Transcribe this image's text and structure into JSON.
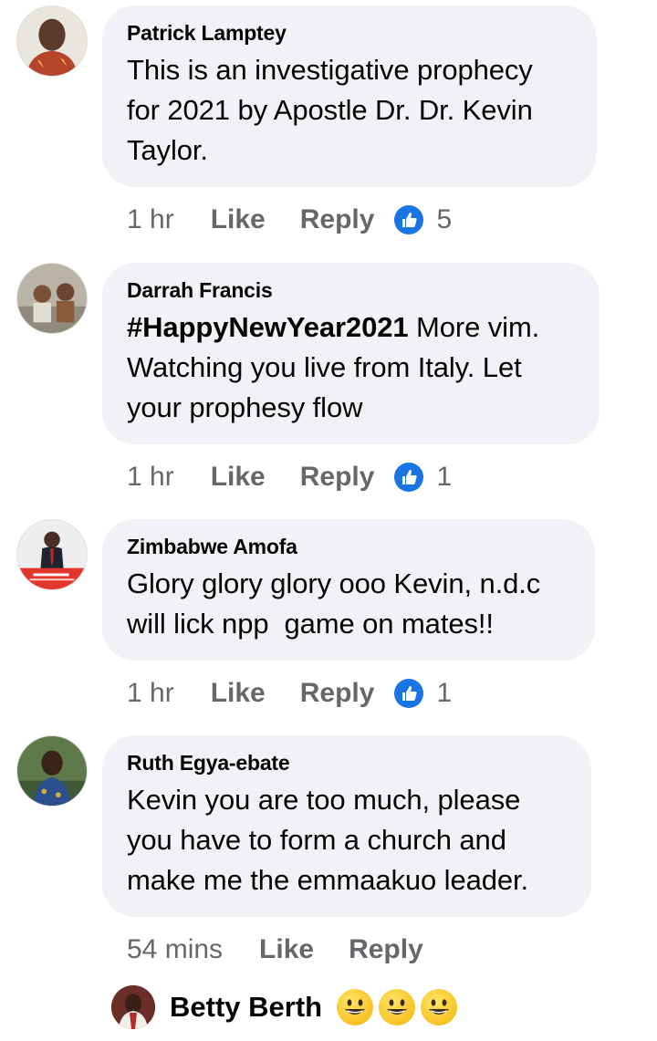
{
  "comments": [
    {
      "author": "Patrick Lamptey",
      "text": "This is an investigative prophecy\nfor 2021 by Apostle Dr. Dr. Kevin\nTaylor.",
      "time": "1 hr",
      "like_label": "Like",
      "reply_label": "Reply",
      "reactions": "5",
      "reaction_icon": "like-thumb-icon"
    },
    {
      "author": "Darrah Francis",
      "hashtag": "#HappyNewYear2021",
      "text": " More vim.\nWatching you live from Italy. Let\nyour prophesy flow",
      "time": "1 hr",
      "like_label": "Like",
      "reply_label": "Reply",
      "reactions": "1",
      "reaction_icon": "like-thumb-icon"
    },
    {
      "author": "Zimbabwe Amofa",
      "text": "Glory glory glory ooo Kevin, n.d.c\nwill lick npp  game on mates!!",
      "time": "1 hr",
      "like_label": "Like",
      "reply_label": "Reply",
      "reactions": "1",
      "reaction_icon": "like-thumb-icon"
    },
    {
      "author": "Ruth Egya-ebate",
      "text": "Kevin you are too much, please\nyou have to form a church and\nmake me the emmaakuo leader.",
      "time": "54 mins",
      "like_label": "Like",
      "reply_label": "Reply"
    }
  ],
  "reply_preview": {
    "author": "Betty Berth",
    "emojis": [
      "grinning-face-icon",
      "grinning-face-icon",
      "grinning-face-icon"
    ]
  },
  "colors": {
    "bubble": "#f0f2f5",
    "meta_text": "#65676b",
    "like_blue": "#1b74e4"
  }
}
